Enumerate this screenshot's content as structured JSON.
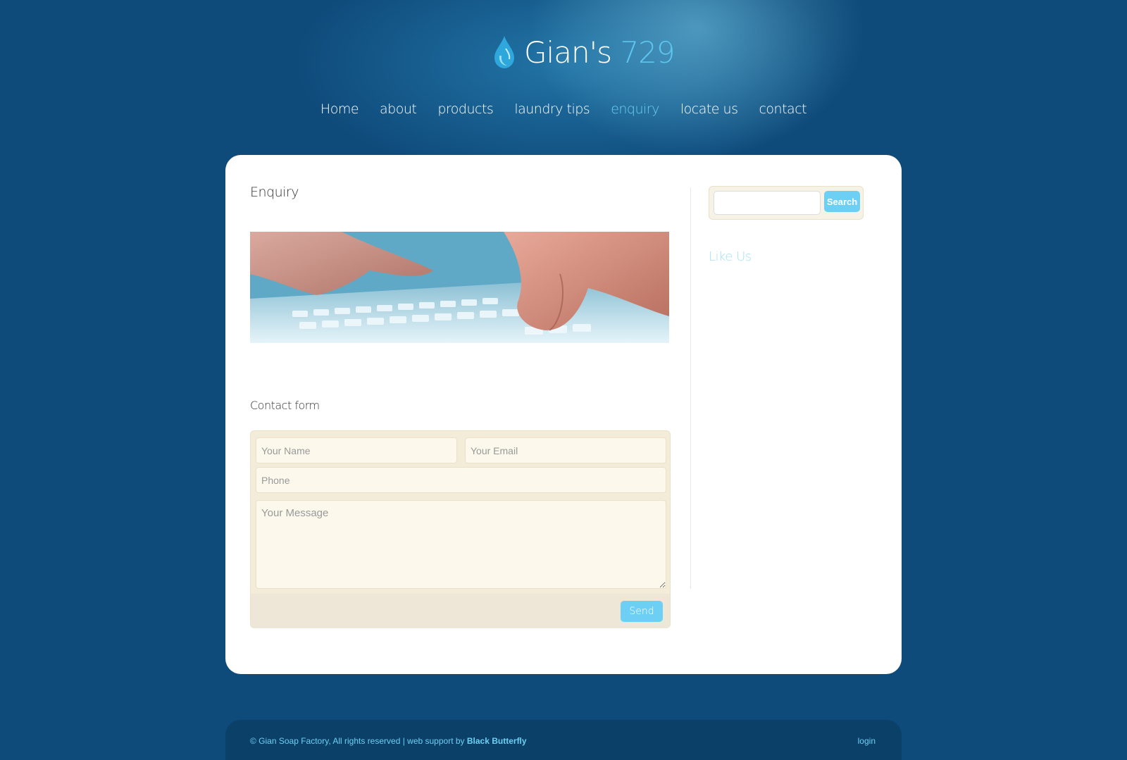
{
  "header": {
    "logo_name": "Gian's",
    "logo_number": "729",
    "logo_icon": "water-drop-icon"
  },
  "nav": {
    "items": [
      {
        "label": "Home"
      },
      {
        "label": "about"
      },
      {
        "label": "products"
      },
      {
        "label": "laundry tips"
      },
      {
        "label": "enquiry",
        "active": true
      },
      {
        "label": "locate us"
      },
      {
        "label": "contact"
      }
    ]
  },
  "main": {
    "page_title": "Enquiry",
    "contact_title": "Contact form",
    "form": {
      "name_placeholder": "Your Name",
      "email_placeholder": "Your Email",
      "phone_placeholder": "Phone",
      "message_placeholder": "Your Message",
      "send_label": "Send"
    }
  },
  "sidebar": {
    "search_label": "Search",
    "like_us_title": "Like Us"
  },
  "footer": {
    "copyright": "© Gian Soap Factory, All rights reserved | web support by ",
    "credit": "Black Butterfly",
    "login_label": "login"
  },
  "colors": {
    "background": "#0e4a7a",
    "accent": "#6dcff3",
    "card": "#ffffff",
    "form_bg": "#f3ecd9"
  }
}
